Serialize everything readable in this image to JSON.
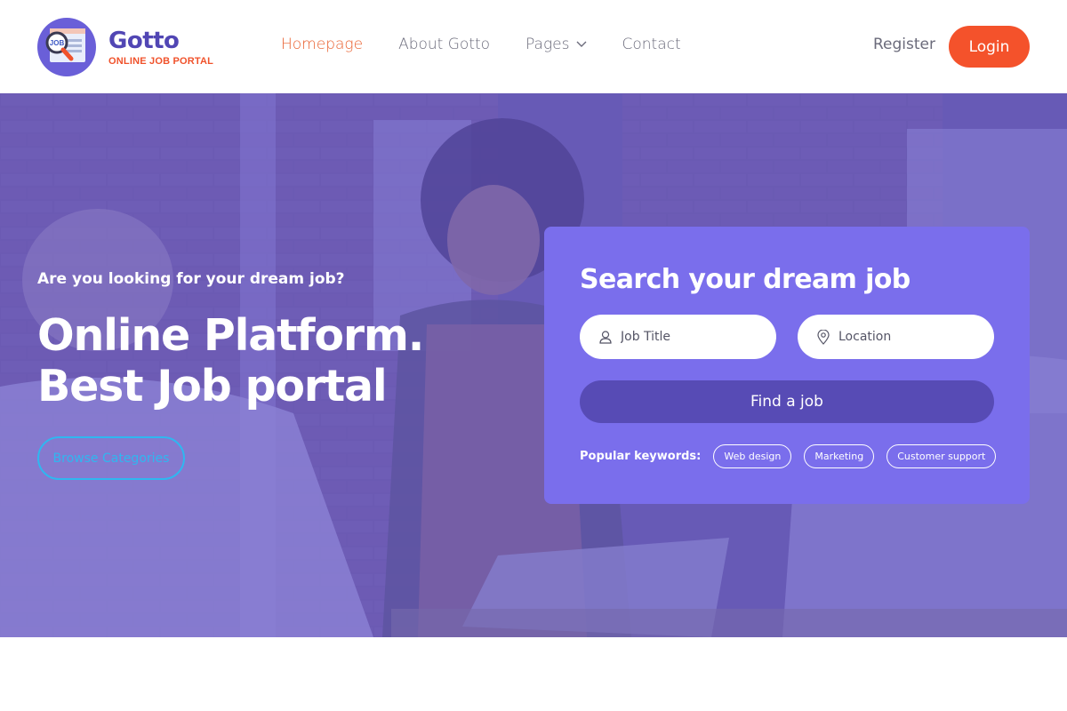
{
  "brand": {
    "name": "Gotto",
    "tagline": "ONLINE JOB PORTAL",
    "badge_text": "JOB"
  },
  "nav": {
    "items": [
      {
        "label": "Homepage",
        "active": true
      },
      {
        "label": "About Gotto",
        "active": false
      },
      {
        "label": "Pages",
        "active": false,
        "has_dropdown": true
      },
      {
        "label": "Contact",
        "active": false
      }
    ]
  },
  "auth": {
    "register_label": "Register",
    "login_label": "Login"
  },
  "hero": {
    "subtitle": "Are you looking for your dream job?",
    "title_line1": "Online Platform.",
    "title_line2": "Best Job portal",
    "browse_label": "Browse Categories"
  },
  "search": {
    "title": "Search your dream job",
    "job_placeholder": "Job Title",
    "location_placeholder": "Location",
    "find_label": "Find a job",
    "keywords_label": "Popular keywords:",
    "keywords": [
      "Web design",
      "Marketing",
      "Customer support"
    ]
  },
  "icons": {
    "user": "user-icon",
    "location": "map-pin-icon",
    "dropdown": "chevron-down-icon",
    "search": "magnifier-icon"
  },
  "colors": {
    "primary": "#5146b4",
    "accent": "#f4522b",
    "card": "#7a6eec",
    "button": "#574bb5",
    "outline": "#2fb7f0"
  }
}
